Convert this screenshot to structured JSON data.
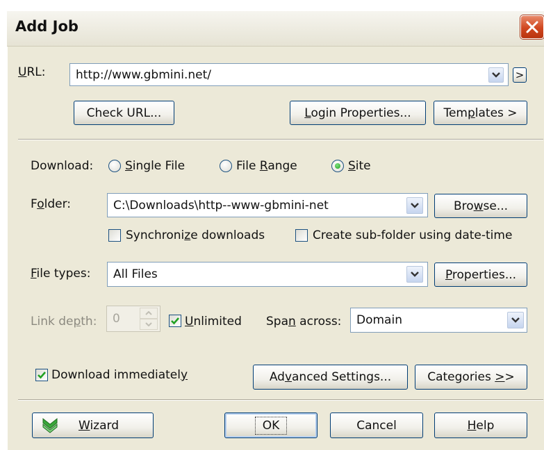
{
  "window": {
    "title": "Add Job"
  },
  "url": {
    "label_pre": "",
    "label_key": "U",
    "label_post": "RL:",
    "value": "http://www.gbmini.net/",
    "go_label": ">"
  },
  "buttons": {
    "check_url": "Check URL...",
    "login_pre": "",
    "login_key": "L",
    "login_post": "ogin Properties...",
    "templates_pre": "Tem",
    "templates_key": "p",
    "templates_post": "lates >",
    "browse_pre": "Bro",
    "browse_key": "w",
    "browse_post": "se...",
    "properties_pre": "",
    "properties_key": "P",
    "properties_post": "roperties...",
    "advanced_pre": "Ad",
    "advanced_key": "v",
    "advanced_post": "anced Settings...",
    "categories_pre": "Categories ",
    "categories_key": ">",
    "categories_post": ">",
    "wizard_pre": "",
    "wizard_key": "W",
    "wizard_post": "izard",
    "ok": "OK",
    "cancel": "Cancel",
    "help_pre": "",
    "help_key": "H",
    "help_post": "elp"
  },
  "download": {
    "label": "Download:",
    "options": [
      {
        "pre": "",
        "key": "S",
        "post": "ingle File",
        "selected": false
      },
      {
        "pre": "File ",
        "key": "R",
        "post": "ange",
        "selected": false
      },
      {
        "pre": "",
        "key": "S",
        "post": "ite",
        "selected": true
      }
    ]
  },
  "folder": {
    "label_pre": "F",
    "label_key": "o",
    "label_post": "lder:",
    "value": "C:\\Downloads\\http--www-gbmini-net"
  },
  "sync": {
    "pre": "Synchroni",
    "key": "z",
    "post": "e downloads",
    "checked": false
  },
  "subfolder": {
    "label": "Create sub-folder using date-time",
    "checked": false
  },
  "file_types": {
    "label_pre": "",
    "label_key": "F",
    "label_post": "ile types:",
    "value": "All Files"
  },
  "link_depth": {
    "label_pre": "Link de",
    "label_key": "p",
    "label_post": "th:",
    "value": "0",
    "unlimited_pre": "",
    "unlimited_key": "U",
    "unlimited_post": "nlimited",
    "unlimited_checked": true
  },
  "span": {
    "label_pre": "Spa",
    "label_key": "n",
    "label_post": " across:",
    "value": "Domain"
  },
  "download_immediately": {
    "pre": "Download immediatel",
    "key": "y",
    "post": "",
    "checked": true
  },
  "colors": {
    "dialog_bg": "#ECE9D8",
    "button_border": "#003c74",
    "field_border": "#7f9db9",
    "close_red": "#d0461f",
    "radio_green": "#21a121"
  }
}
